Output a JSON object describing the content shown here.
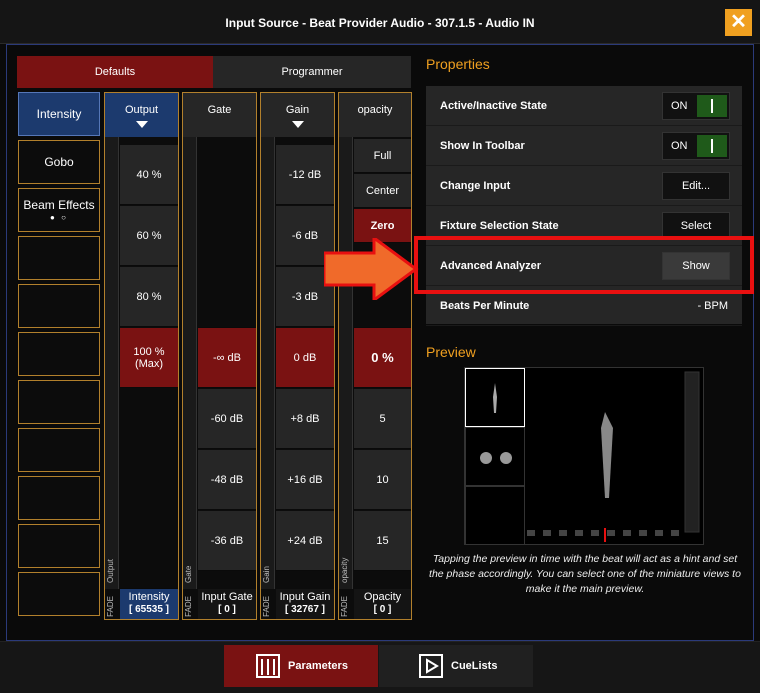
{
  "window": {
    "title": "Input Source - Beat Provider Audio - 307.1.5 - Audio IN",
    "close_glyph": "✕"
  },
  "tabs": {
    "defaults": "Defaults",
    "programmer": "Programmer"
  },
  "categories": [
    {
      "label": "Intensity",
      "active": true
    },
    {
      "label": "Gobo"
    },
    {
      "label": "Beam Effects",
      "dots": "● ○"
    }
  ],
  "faders": {
    "output": {
      "header": "Output",
      "vertical_label": "Output",
      "cells": [
        "40 %",
        "60 %",
        "80 %",
        "100 %\n(Max)"
      ],
      "footer_name": "Intensity",
      "footer_value": "[ 65535 ]"
    },
    "gate": {
      "header": "Gate",
      "vertical_label": "Gate",
      "cells": [
        "-∞ dB",
        "-60 dB",
        "-48 dB",
        "-36 dB"
      ],
      "footer_name": "Input Gate",
      "footer_value": "[ 0 ]"
    },
    "gain": {
      "header": "Gain",
      "vertical_label": "Gain",
      "cells": [
        "-12 dB",
        "-6 dB",
        "-3 dB",
        "0 dB",
        "+8 dB",
        "+16 dB",
        "+24 dB"
      ],
      "footer_name": "Input Gain",
      "footer_value": "[ 32767 ]"
    },
    "opacity": {
      "header": "opacity",
      "vertical_label": "opacity",
      "cells": [
        "Full",
        "Center",
        "Zero",
        "0 %",
        "5",
        "10",
        "15"
      ],
      "footer_name": "Opacity",
      "footer_value": "[ 0 ]"
    },
    "fade_label": "FADE"
  },
  "properties": {
    "title": "Properties",
    "rows": [
      {
        "label": "Active/Inactive State",
        "control": "ON"
      },
      {
        "label": "Show In Toolbar",
        "control": "ON"
      },
      {
        "label": "Change Input",
        "control": "Edit..."
      },
      {
        "label": "Fixture Selection State",
        "control": "Select"
      },
      {
        "label": "Advanced Analyzer",
        "control": "Show"
      },
      {
        "label": "Beats Per Minute",
        "control": "- BPM"
      }
    ]
  },
  "preview": {
    "title": "Preview",
    "caption": "Tapping the preview in time with the beat will act as a hint and set the phase accordingly. You can select one of the miniature views to make it the main preview."
  },
  "bottom_tabs": {
    "parameters": "Parameters",
    "cuelists": "CueLists"
  },
  "colors": {
    "accent": "#f0a020",
    "selected_red": "#7a1212",
    "highlight": "#e81010",
    "arrow": "#f06a2a",
    "blue": "#1c3a6e"
  }
}
